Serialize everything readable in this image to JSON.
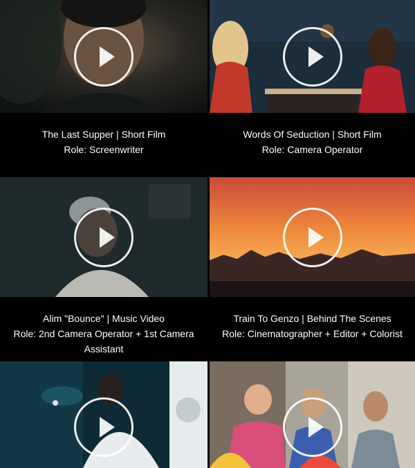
{
  "items": [
    {
      "title": "The Last Supper | Short Film",
      "role": "Role: Screenwriter",
      "play_icon": "play-icon"
    },
    {
      "title": "Words Of Seduction | Short Film",
      "role": "Role: Camera Operator",
      "play_icon": "play-icon"
    },
    {
      "title": "Alim \"Bounce\" | Music Video",
      "role": "Role: 2nd Camera Operator + 1st Camera Assistant",
      "play_icon": "play-icon"
    },
    {
      "title": "Train To Genzo | Behind The Scenes",
      "role": "Role: Cinematographer + Editor + Colorist",
      "play_icon": "play-icon"
    },
    {
      "title": "",
      "role": "",
      "play_icon": "play-icon"
    },
    {
      "title": "",
      "role": "",
      "play_icon": "play-icon"
    }
  ],
  "colors": {
    "background": "#000000",
    "text": "#ffffff",
    "play_ring": "#ffffff"
  }
}
